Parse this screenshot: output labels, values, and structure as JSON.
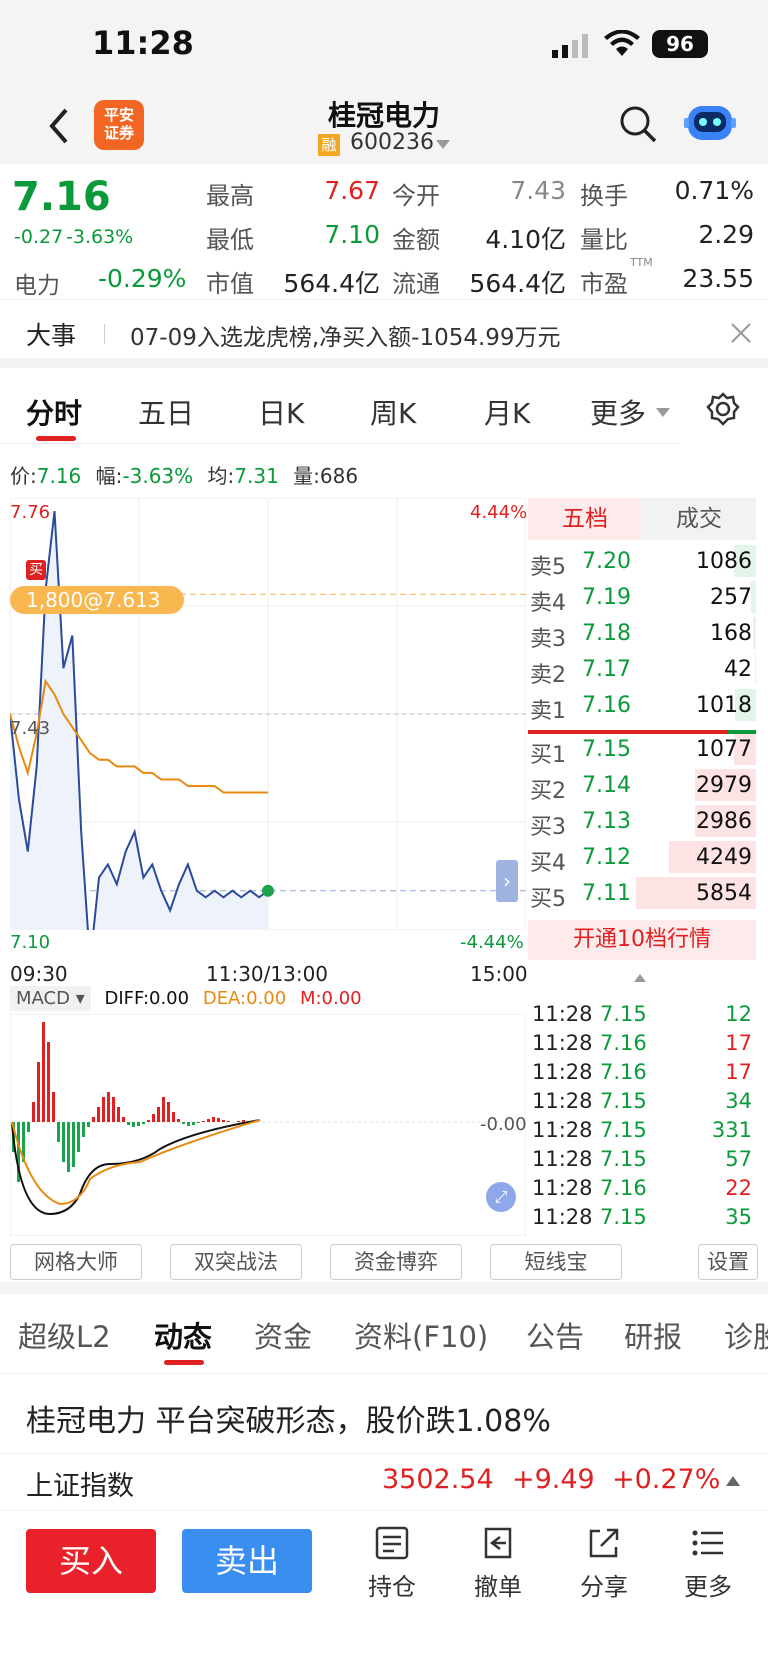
{
  "status": {
    "time": "11:28",
    "battery": "96"
  },
  "nav": {
    "title": "桂冠电力",
    "code": "600236",
    "margin_badge": "融",
    "broker_logo": "平安\n证券"
  },
  "quote": {
    "price": "7.16",
    "change": "-0.27",
    "change_pct": "-3.63%",
    "sector": "电力",
    "sector_pct": "-0.29%",
    "high_label": "最高",
    "high": "7.67",
    "low_label": "最低",
    "low": "7.10",
    "mktcap_label": "市值",
    "mktcap": "564.4亿",
    "open_label": "今开",
    "open": "7.43",
    "amount_label": "金额",
    "amount": "4.10亿",
    "float_label": "流通",
    "float": "564.4亿",
    "turnover_label": "换手",
    "turnover": "0.71%",
    "volratio_label": "量比",
    "volratio": "2.29",
    "pe_label": "市盈",
    "pe_sup": "TTM",
    "pe": "23.55"
  },
  "event": {
    "label": "大事",
    "text": "07-09入选龙虎榜,净买入额-1054.99万元"
  },
  "chart_tabs": [
    "分时",
    "五日",
    "日K",
    "周K",
    "月K",
    "更多"
  ],
  "info_line": {
    "price_label": "价:",
    "price": "7.16",
    "range_label": "幅:",
    "range": "-3.63%",
    "avg_label": "均:",
    "avg": "7.31",
    "vol_label": "量:",
    "vol": "686"
  },
  "intraday": {
    "ymax": "7.76",
    "ymin": "7.10",
    "pmax": "4.44%",
    "pmin": "-4.44%",
    "ref": "7.43",
    "buy_marker": "买",
    "buy_tag": "1,800@7.613",
    "t_start": "09:30",
    "t_mid": "11:30/13:00",
    "t_end": "15:00"
  },
  "chart_data": {
    "type": "line",
    "title": "",
    "ylim": [
      7.1,
      7.76
    ],
    "series": [
      {
        "values": [
          7.43,
          7.3,
          7.22,
          7.35,
          7.62,
          7.74,
          7.5,
          7.55,
          7.25,
          7.05,
          7.18,
          7.2,
          7.17,
          7.22,
          7.25,
          7.18,
          7.2,
          7.16,
          7.13,
          7.17,
          7.2,
          7.16,
          7.15,
          7.16,
          7.15,
          7.16,
          7.15,
          7.16,
          7.15,
          7.16
        ]
      },
      {
        "values": [
          7.43,
          7.38,
          7.34,
          7.4,
          7.48,
          7.46,
          7.43,
          7.41,
          7.39,
          7.37,
          7.36,
          7.36,
          7.35,
          7.35,
          7.35,
          7.34,
          7.34,
          7.33,
          7.33,
          7.33,
          7.32,
          7.32,
          7.32,
          7.32,
          7.31,
          7.31,
          7.31,
          7.31,
          7.31,
          7.31
        ]
      }
    ]
  },
  "macd": {
    "label": "MACD",
    "diff": "DIFF:0.00",
    "dea": "DEA:0.00",
    "m": "M:0.00",
    "zero": "-0.00"
  },
  "orderbook": {
    "tabs": [
      "五档",
      "成交"
    ],
    "asks": [
      {
        "label": "卖5",
        "price": "7.20",
        "vol": "1086"
      },
      {
        "label": "卖4",
        "price": "7.19",
        "vol": "257"
      },
      {
        "label": "卖3",
        "price": "7.18",
        "vol": "168"
      },
      {
        "label": "卖2",
        "price": "7.17",
        "vol": "42"
      },
      {
        "label": "卖1",
        "price": "7.16",
        "vol": "1018"
      }
    ],
    "bids": [
      {
        "label": "买1",
        "price": "7.15",
        "vol": "1077"
      },
      {
        "label": "买2",
        "price": "7.14",
        "vol": "2979"
      },
      {
        "label": "买3",
        "price": "7.13",
        "vol": "2986"
      },
      {
        "label": "买4",
        "price": "7.12",
        "vol": "4249"
      },
      {
        "label": "买5",
        "price": "7.11",
        "vol": "5854"
      }
    ],
    "upgrade": "开通10档行情"
  },
  "trades": [
    {
      "time": "11:28",
      "price": "7.15",
      "vol": "12",
      "dir": "green"
    },
    {
      "time": "11:28",
      "price": "7.16",
      "vol": "17",
      "dir": "red"
    },
    {
      "time": "11:28",
      "price": "7.16",
      "vol": "17",
      "dir": "red"
    },
    {
      "time": "11:28",
      "price": "7.15",
      "vol": "34",
      "dir": "green"
    },
    {
      "time": "11:28",
      "price": "7.15",
      "vol": "331",
      "dir": "green"
    },
    {
      "time": "11:28",
      "price": "7.15",
      "vol": "57",
      "dir": "green"
    },
    {
      "time": "11:28",
      "price": "7.16",
      "vol": "22",
      "dir": "red"
    },
    {
      "time": "11:28",
      "price": "7.15",
      "vol": "35",
      "dir": "green"
    }
  ],
  "tools": [
    "网格大师",
    "双突战法",
    "资金博弈",
    "短线宝",
    "设置"
  ],
  "lower_tabs": [
    "超级L2",
    "动态",
    "资金",
    "资料(F10)",
    "公告",
    "研报",
    "诊股"
  ],
  "news": {
    "headline": "桂冠电力 平台突破形态，股价跌1.08%"
  },
  "index": {
    "name": "上证指数",
    "value": "3502.54",
    "change": "+9.49",
    "pct": "+0.27%"
  },
  "bottom": {
    "buy": "买入",
    "sell": "卖出",
    "items": [
      "持仓",
      "撤单",
      "分享",
      "更多"
    ]
  }
}
